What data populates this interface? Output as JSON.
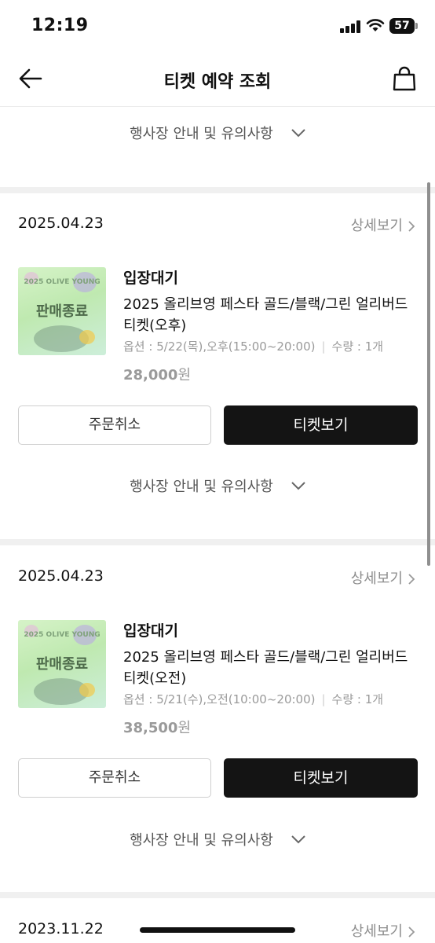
{
  "status_bar": {
    "time": "12:19",
    "battery": "57"
  },
  "nav": {
    "title": "티켓 예약 조회",
    "back_icon": "arrow-left-icon",
    "bag_icon": "shopping-bag-icon"
  },
  "notice_label": "행사장 안내 및 유의사항",
  "orders": [
    {
      "date": "2025.04.23",
      "detail_label": "상세보기",
      "thumb_small": "2025 OLIVE YOUNG",
      "thumb_badge": "판매종료",
      "status": "입장대기",
      "product": "2025 올리브영 페스타 골드/블랙/그린 얼리버드 티켓(오후)",
      "option": "옵션 : 5/22(목),오후(15:00~20:00)",
      "quantity": "수량 : 1개",
      "price": "28,000",
      "currency": "원",
      "cancel_label": "주문취소",
      "ticket_label": "티켓보기"
    },
    {
      "date": "2025.04.23",
      "detail_label": "상세보기",
      "thumb_small": "2025 OLIVE YOUNG",
      "thumb_badge": "판매종료",
      "status": "입장대기",
      "product": "2025 올리브영 페스타 골드/블랙/그린 얼리버드 티켓(오전)",
      "option": "옵션 : 5/21(수),오전(10:00~20:00)",
      "quantity": "수량 : 1개",
      "price": "38,500",
      "currency": "원",
      "cancel_label": "주문취소",
      "ticket_label": "티켓보기"
    },
    {
      "date": "2023.11.22",
      "detail_label": "상세보기"
    }
  ]
}
